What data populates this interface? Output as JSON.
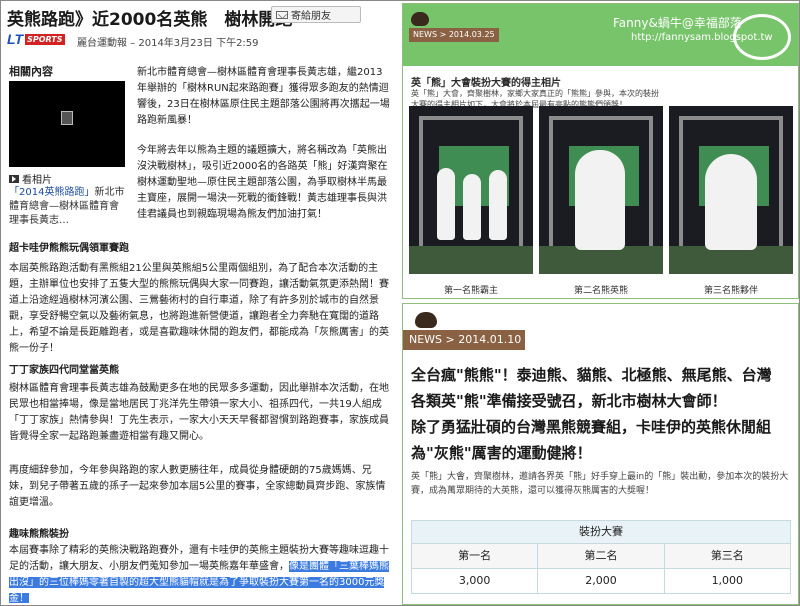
{
  "article": {
    "headline": "英熊路跑》近2000名英熊　樹林開跑",
    "share_label": "寄給朋友",
    "logo_lt": "LT",
    "logo_sports": "SPORTS",
    "byline": "麗台運動報 – 2014年3月23日 下午2:59",
    "related_title": "相關內容",
    "watch_label": "看相片",
    "watch_caption_link": "「2014英熊路跑」",
    "watch_caption_rest": "新北市體育總會—樹林區體育會理事長黃志…",
    "p1": "新北市體育總會—樹林區體育會理事長黃志雄，繼2013年舉辦的「樹林RUN起來路跑賽」獲得眾多跑友的熱情迴響後，23日在樹林區原住民主題部落公園將再次攜起一場路跑新風暴！",
    "p2": "今年將去年以熊為主題的議題擴大，將名稱改為「英熊出沒決戰樹林」，吸引近2000名的各路英「熊」好漢齊聚在樹林運動聖地—原住民主題部落公園，為爭取樹林半馬最主寶座，展開一場決一死戰的衝鋒戰！黃志雄理事長與洪佳君議員也到親臨現場為熊友們加油打氣！",
    "h1": "超卡哇伊熊熊玩偶領軍賽跑",
    "p3": "本屆英熊路跑活動有黑熊組21公里與英熊組5公里兩個組別，為了配合本次活動的主題，主辦單位也安排了五隻大型的熊熊玩偶與大家一同賽跑，讓活動氣氛更添熱鬧！賽道上沿途經過樹林河濱公園、三鶯藝術村的自行車道，除了有許多別於城市的自然景觀，享受舒暢空氣以及藝術氣息，也將跑進新營便道，讓跑者全力奔馳在寬闊的道路上，希望不論是長距離跑者，或是喜歡趣味休閒的跑友們，都能成為「灰熊厲害」的英熊一份子！",
    "h2": "丁丁家族四代同堂當英熊",
    "p4": "樹林區體育會理事長黃志雄為鼓勵更多在地的民眾多多運動，因此舉辦本次活動，在地民眾也相當捧場，像是當地居民丁兆洋先生帶領一家大小、祖孫四代，一共19人組成「丁丁家族」熱情參與！丁先生表示，一家大小天天早餐都習慣到路跑賽事，家族成員皆覺得全家一起路跑兼盡遊相當有趣又開心。",
    "p5": "再度細辞參加，今年參與路跑的家人數更勝往年，成員從身體硬朗的75歲媽媽、兄妹，到兒子帶著五歲的孫子一起來參加本屆5公里的賽事，全家總動員齊步跑、家族情誼更增溫。",
    "h3": "趣味熊熊裝扮",
    "p6_normal": "本屆賽事除了精彩的英熊決戰路跑賽外，還有卡哇伊的英熊主題裝扮大賽等趣味逗趣十足的活動，讓大朋友、小朋友們蒐知參加一場英熊嘉年華盛會，",
    "p6_highlight": "像是團體「三葉棒媽熊出沒」的三位棒媽零著自製的超大型熊貓帽就是為了爭取裝扮大賽第一名的3000元獎金！"
  },
  "blog_top": {
    "news_tag": "NEWS > 2014.03.25",
    "blog_title": "Fanny&蝸牛@幸福部落",
    "blog_url": "http://fannysam.blogspot.tw",
    "post_title": "英「熊」大會裝扮大賽的得主相片",
    "post_sub": "英「熊」大會，齊聚樹林，家鄉大家真正的「熊熊」參與，本次的裝扮大賽的得主相片如下，大會將於本屆最有亮點的熊熊們頒獎！",
    "captions": [
      "第一名熊霸主",
      "第二名熊英熊",
      "第三名熊夥伴"
    ]
  },
  "news_bottom": {
    "news_bar": "NEWS > 2014.01.10",
    "line1_quote": "全台瘋\"熊熊\"！泰迪熊、貓熊、北極熊、無尾熊、台灣",
    "line2": "各類英\"熊\"準備接受號召，新北市樹林大會師！",
    "line3": "除了勇猛壯碩的台灣黑熊競賽組，卡哇伊的英熊休閒組",
    "line4": "為\"灰熊\"厲害的運動健將！",
    "small_p": "英「熊」大會，齊聚樹林，邀請各界英「熊」好手穿上最in的「熊」裝出動，參加本次的裝扮大賽，成為萬眾期待的大英熊，還可以獲得灰熊厲害的大獎喔！",
    "contest_title": "裝扮大賽",
    "table_head": [
      "第一名",
      "第二名",
      "第三名"
    ],
    "table_row": [
      "3,000",
      "2,000",
      "1,000"
    ]
  },
  "colors": {
    "banner_green": "#78c46b",
    "news_brown": "#8a6243",
    "highlight_blue": "#3b7be0",
    "link_blue": "#1a4a9c"
  }
}
